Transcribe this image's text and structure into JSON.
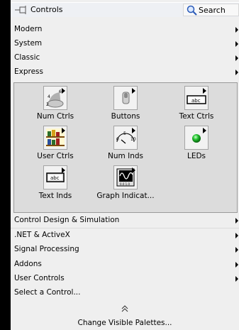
{
  "palette": {
    "title": "Controls",
    "search_label": "Search",
    "categories_top": [
      {
        "label": "Modern",
        "has_submenu": true
      },
      {
        "label": "System",
        "has_submenu": true
      },
      {
        "label": "Classic",
        "has_submenu": true
      },
      {
        "label": "Express",
        "has_submenu": true
      }
    ],
    "express_items": [
      {
        "label": "Num Ctrls",
        "icon": "num-ctrls-icon"
      },
      {
        "label": "Buttons",
        "icon": "buttons-icon"
      },
      {
        "label": "Text Ctrls",
        "icon": "text-ctrls-icon"
      },
      {
        "label": "User Ctrls",
        "icon": "user-ctrls-icon"
      },
      {
        "label": "Num Inds",
        "icon": "num-inds-icon"
      },
      {
        "label": "LEDs",
        "icon": "leds-icon"
      },
      {
        "label": "Text Inds",
        "icon": "text-inds-icon"
      },
      {
        "label": "Graph Indicat...",
        "icon": "graph-indicators-icon"
      }
    ],
    "categories_bottom": [
      {
        "label": "Control Design & Simulation",
        "has_submenu": true
      },
      {
        "label": ".NET & ActiveX",
        "has_submenu": true
      },
      {
        "label": "Signal Processing",
        "has_submenu": true
      },
      {
        "label": "Addons",
        "has_submenu": true
      },
      {
        "label": "User Controls",
        "has_submenu": true
      },
      {
        "label": "Select a Control...",
        "has_submenu": false
      }
    ],
    "collapse_glyph": "«",
    "change_palettes_label": "Change Visible Palettes..."
  },
  "colors": {
    "palette_bg": "#efefef",
    "subpalette_bg": "#dcdcdc",
    "left_strip": "#000000",
    "led_green": "#22c22e"
  }
}
